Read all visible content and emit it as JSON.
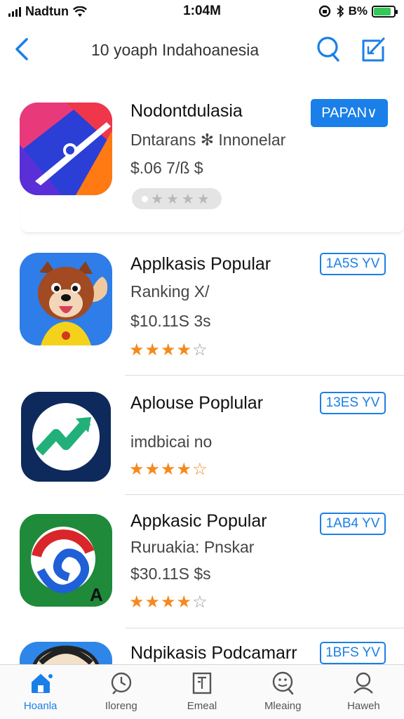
{
  "status_bar": {
    "carrier": "Nadtun",
    "time": "1:04M",
    "battery_text": "B%",
    "battery_level": 0.85
  },
  "nav": {
    "back_icon": "chevron-left-icon",
    "title": "10 yoaph Indahoanesia",
    "search_icon": "search-icon",
    "edit_icon": "compose-icon"
  },
  "apps": [
    {
      "name": "Nodontdulasia",
      "subtitle": "Dntarans ✻ Innonelar",
      "price": "$.06 7/ß $",
      "button": "PAPAN∨",
      "rating": 0
    },
    {
      "name": "Applkasis Popular",
      "subtitle": "Ranking X/",
      "price": "$10.11S 3s",
      "button": "1A5S YV",
      "rating": 4
    },
    {
      "name": "Aplouse Poplular",
      "subtitle": "",
      "price": "imdbicai no",
      "button": "13ES YV",
      "rating": 4.5
    },
    {
      "name": "Appkasic Popular",
      "subtitle": "Ruruakia: Pnskar",
      "price": "$30.11S $s",
      "button": "1AB4 YV",
      "rating": 4
    },
    {
      "name": "Ndpikasis Podcamarr",
      "subtitle": "",
      "price": "",
      "button": "1BFS YV",
      "rating": 0
    }
  ],
  "tabs": [
    {
      "label": "Hoanla",
      "icon": "home-icon",
      "active": true
    },
    {
      "label": "Iloreng",
      "icon": "clock-icon",
      "active": false
    },
    {
      "label": "Emeal",
      "icon": "document-icon",
      "active": false
    },
    {
      "label": "Mleaing",
      "icon": "search-chat-icon",
      "active": false
    },
    {
      "label": "Haweh",
      "icon": "person-icon",
      "active": false
    }
  ],
  "colors": {
    "accent": "#1a7fe8",
    "star": "#f5891e",
    "battery": "#34c759"
  }
}
